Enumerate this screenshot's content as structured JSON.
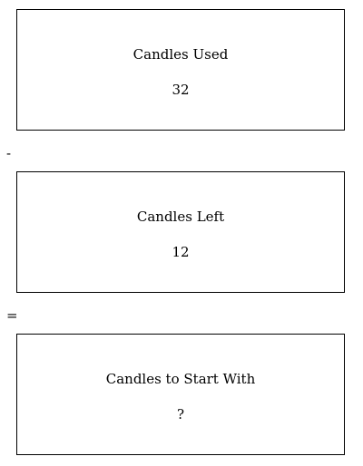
{
  "boxes": [
    {
      "label": "Candles Used",
      "value": "32"
    },
    {
      "label": "Candles Left",
      "value": "12"
    },
    {
      "label": "Candles to Start With",
      "value": "?"
    }
  ],
  "operators": {
    "minus": "-",
    "equals": "="
  }
}
